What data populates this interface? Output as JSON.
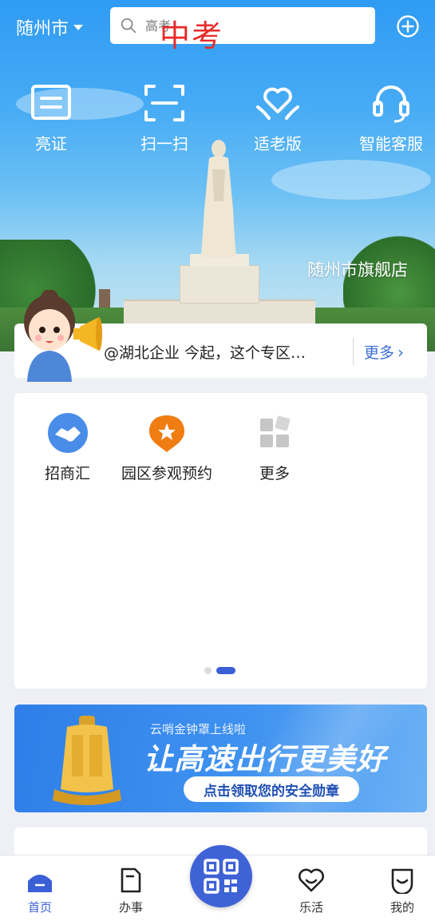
{
  "header": {
    "city": "随州市",
    "search_placeholder": "高考",
    "overlay_text": "中考"
  },
  "quick_actions": [
    {
      "label": "亮证",
      "icon": "id-card-icon"
    },
    {
      "label": "扫一扫",
      "icon": "scan-icon"
    },
    {
      "label": "适老版",
      "icon": "heart-hands-icon"
    },
    {
      "label": "智能客服",
      "icon": "headset-icon"
    }
  ],
  "hero": {
    "caption": "随州市旗舰店"
  },
  "notice": {
    "text": "@湖北企业 今起，这个专区…",
    "more": "更多"
  },
  "services": [
    {
      "label": "招商汇",
      "icon": "handshake-icon",
      "color": "#4a8de8"
    },
    {
      "label": "园区参观预约",
      "icon": "pin-star-icon",
      "color": "#f07d12"
    },
    {
      "label": "更多",
      "icon": "more-grid-icon",
      "color": "#c6c6c6"
    }
  ],
  "pager": {
    "current": 2,
    "total": 2
  },
  "banner": {
    "small": "云哨金钟罩上线啦",
    "big": "让高速出行更美好",
    "button": "点击领取您的安全勋章"
  },
  "tabbar": {
    "items": [
      {
        "label": "首页",
        "active": true
      },
      {
        "label": "办事",
        "active": false
      },
      {
        "label": "乐活",
        "active": false
      },
      {
        "label": "我的",
        "active": false
      }
    ]
  },
  "colors": {
    "accent": "#3a5fd6",
    "sky": "#2f9bf4",
    "link": "#3b6fd4"
  }
}
